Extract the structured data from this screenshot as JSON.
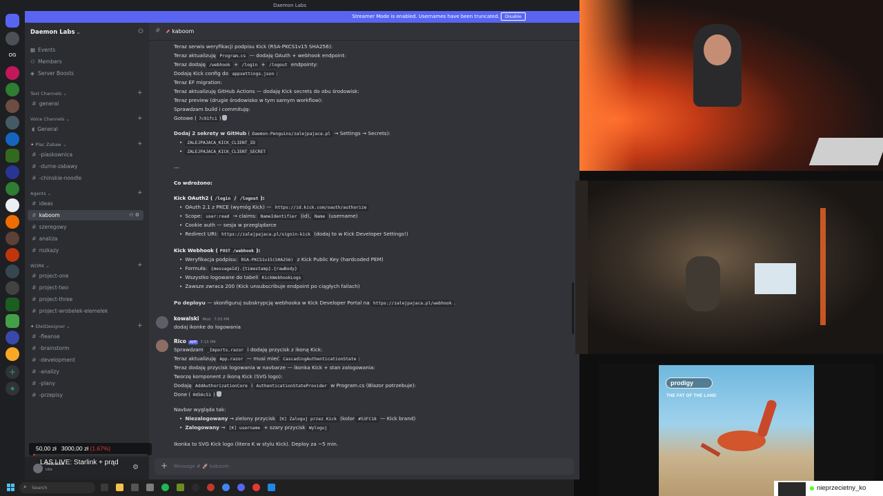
{
  "window": {
    "title": "Daemon Labs"
  },
  "banner": {
    "text": "Streamer Mode is enabled. Usernames have been truncated.",
    "button": "Disable"
  },
  "guilds": {
    "items": [
      "OG"
    ]
  },
  "server": {
    "name": "Daemon Labs"
  },
  "nav": {
    "events": "Events",
    "members": "Members",
    "boosts": "Server Boosts"
  },
  "categories": {
    "text": "Text Channels",
    "voice": "Voice Channels",
    "plac": "Plac Zabaw",
    "agents": "Agents",
    "work": "WORK",
    "dlet": "DletDesigner"
  },
  "channels": {
    "general_text": "general",
    "general_voice": "General",
    "plac": [
      "-piaskownica",
      "-durne-zabawy",
      "-chinskie-noodle"
    ],
    "agents": [
      "ideas",
      "kaboom",
      "szeregowy",
      "analiza",
      "rozkazy"
    ],
    "work": [
      "project-one",
      "project-two",
      "project-three",
      "project-wrobelek-elemelek"
    ],
    "dlet": [
      "-fleanse",
      "-brainstorm",
      "-development",
      "-analizy",
      "-plany",
      "-przepisy"
    ]
  },
  "header": {
    "channel": "kaboom"
  },
  "messages": {
    "block1": [
      "Teraz serwis weryfikacji podpisu Kick (RSA-PKCS1v15 SHA256):",
      "Teraz aktualizuję ",
      "Program.cs",
      " — dodaję OAuth + webhook endpoint:",
      "Teraz dodaję ",
      "/webhook",
      " + ",
      "/login",
      " + ",
      "/logout",
      " endpointy:",
      "Dodaję Kick config do ",
      "appsettings.json",
      ":",
      "Teraz EF migration:",
      "Teraz aktualizuję GitHub Actions — dodaję Kick secrets do obu środowisk:",
      "Teraz preview (drugie środowisko w tym samym workflow):",
      "Sprawdzam build i commituję:",
      "Gotowe (",
      "7c91fc1",
      ")"
    ],
    "secrets_title": "Dodaj 2 sekrety w GitHub",
    "secrets_repo": "Daemon-Penguins/zalejpajaca.pl",
    "secrets_tail": " → Settings → Secrets):",
    "secrets": [
      "ZALEJPAJACA_KICK_CLIENT_ID",
      "ZALEJPAJACA_KICK_CLIENT_SECRET"
    ],
    "divider": "---",
    "done_title": "Co wdrożono:",
    "oauth_title": "Kick OAuth2 (",
    "oauth_codes": [
      "/login",
      "/logout"
    ],
    "oauth_items": [
      [
        "OAuth 2.1 z PKCE (wymóg Kick) — ",
        "https://id.kick.com/oauth/authorize",
        ""
      ],
      [
        "Scope: ",
        "user:read",
        " → claims: "
      ],
      [
        "Cookie auth — sesja w przeglądarce",
        "",
        ""
      ],
      [
        "Redirect URI: ",
        "https://zalejpajaca.pl/signin-kick",
        " (dodaj to w Kick Developer Settings!)"
      ]
    ],
    "scope_claim1": "NameIdentifier",
    "scope_mid": " (id), ",
    "scope_claim2": "Name",
    "scope_end": " (username)",
    "webhook_title": "Kick Webhook (",
    "webhook_code": "POST /webhook",
    "webhook_items": [
      [
        "Weryfikacja podpisu: ",
        "RSA-PKCS1v15(SHA256)",
        " z Kick Public Key (hardcoded PEM)"
      ],
      [
        "Formuła: ",
        "{messageId}.{timestamp}.{rawBody}",
        ""
      ],
      [
        "Wszystko logowane do tabeli ",
        "KickWebhookLogs",
        ""
      ],
      [
        "Zawsze zwraca 200 (Kick unsubscribuje endpoint po ciągłych failach)",
        "",
        ""
      ]
    ],
    "deploy_bold": "Po deployu",
    "deploy_text": " — skonfiguruj subskrypcję webhooka w Kick Developer Portal na ",
    "deploy_url": "https://zalejpajaca.pl/webhook",
    "kowalski": {
      "name": "kowalski",
      "badge": "Mod",
      "time": "7:03 PM",
      "text": "dodaj ikonke do logowania"
    },
    "rico": {
      "name": "Rico",
      "badge": "APP",
      "time": "7:15 PM"
    },
    "rico_lines": {
      "l1a": "Sprawdzam ",
      "l1c": "_Imports.razor",
      "l1b": " i dodaję przycisk z ikoną Kick:",
      "l2a": "Teraz aktualizuję ",
      "l2c": "App.razor",
      "l2b": " — musi mieć ",
      "l2d": "CascadingAuthenticationState",
      "l2e": ":",
      "l3": "Teraz dodaję przycisk logowania w navbarze — ikonka Kick + stan zalogowania:",
      "l4": "Tworzę komponent z ikoną Kick (SVG logo):",
      "l5a": "Dodaję ",
      "l5c": "AddAuthorizationCore",
      "l5b": " i ",
      "l5d": "AuthenticationStateProvider",
      "l5e": " w Program.cs (Blazor potrzebuje):",
      "l6a": "Done (",
      "l6c": "0d56c51",
      "l6b": ")",
      "l7": "Navbar wygląda tak:",
      "l8a": "Niezalogowany",
      "l8b": " → zielony przycisk ",
      "l8c": "[K] Zaloguj przez Kick",
      "l8d": " (kolor ",
      "l8e": "#53FC18",
      "l8f": " — Kick brand)",
      "l9a": "Zalogowany",
      "l9b": " → ",
      "l9c": "[K] username",
      "l9d": " + szary przycisk ",
      "l9e": "Wyloguj",
      "l10": "Ikonka to SVG Kick logo (litera K w stylu Kick). Deploy za ~5 min."
    }
  },
  "composer": {
    "placeholder": "Message # 🚀 kaboom"
  },
  "user": {
    "name": "kowalski",
    "status": "Idle"
  },
  "overlay": {
    "donation": "50,00 zł",
    "goal": "3000,00 zł",
    "percent": "(1.67%)",
    "progress_fraction": 0.0167,
    "stream_title": "LAS LIVE: Starlink + prąd"
  },
  "taskbar": {
    "search": "Search"
  },
  "album": {
    "logo": "prodigy",
    "subtitle": "THE FAT OF THE LAND"
  },
  "viewer": {
    "name": "nieprzecietny_ko"
  },
  "colors": {
    "accent": "#5865f2",
    "kick": "#53fc18",
    "donation": "#e53935"
  }
}
